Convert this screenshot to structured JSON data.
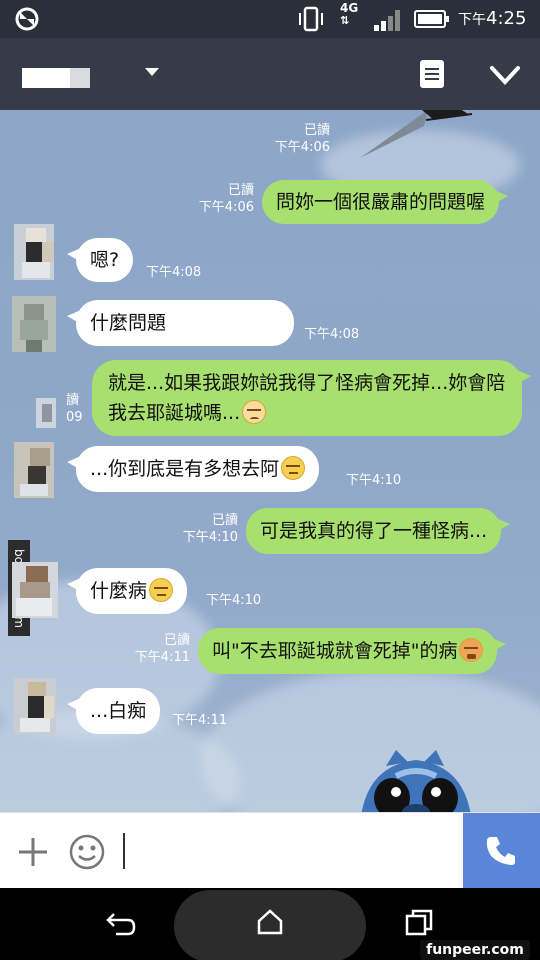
{
  "status_bar": {
    "network": "4G",
    "time_prefix": "下午",
    "time": "4:25"
  },
  "header": {
    "contact_name": ""
  },
  "watermark_side": "bomb01.com",
  "watermark_bottom": "funpeer.com",
  "messages": [
    {
      "side": "out",
      "text": "",
      "read": "已讀",
      "time": "下午4:06",
      "partial": true
    },
    {
      "side": "out",
      "text": "問妳一個很嚴肅的問題喔",
      "read": "已讀",
      "time": "下午4:06"
    },
    {
      "side": "in",
      "text": "嗯?",
      "time": "下午4:08"
    },
    {
      "side": "in",
      "text": "什麼問題",
      "time": "下午4:08"
    },
    {
      "side": "out",
      "text": "就是...如果我跟妳說我得了怪病會死掉...妳會陪我去耶誕城嗎...",
      "read": "讀",
      "time": "09",
      "emoji": "sad-face"
    },
    {
      "side": "in",
      "text": "...你到底是有多想去阿",
      "time": "下午4:10",
      "emoji": "expressionless-face"
    },
    {
      "side": "out",
      "text": "可是我真的得了一種怪病...",
      "read": "已讀",
      "time": "下午4:10"
    },
    {
      "side": "in",
      "text": "什麼病",
      "time": "下午4:10",
      "emoji": "expressionless-face"
    },
    {
      "side": "out",
      "text": "叫\"不去耶誕城就會死掉\"的病",
      "read": "已讀",
      "time": "下午4:11",
      "emoji": "crying-face"
    },
    {
      "side": "in",
      "text": "...白痴",
      "time": "下午4:11"
    }
  ],
  "input": {
    "placeholder": ""
  },
  "colors": {
    "header_bg": "#353b48",
    "outgoing_bubble": "#a8e06f",
    "incoming_bubble": "#ffffff",
    "call_button": "#5b85d6"
  }
}
